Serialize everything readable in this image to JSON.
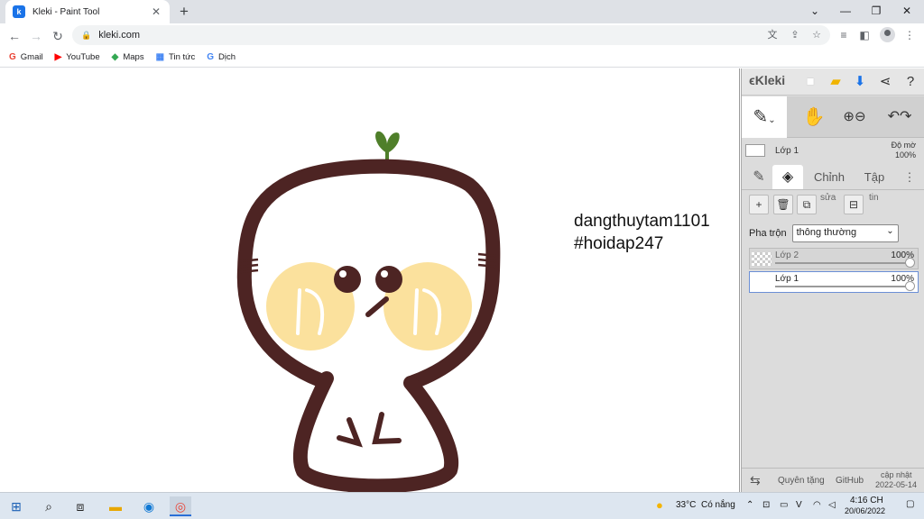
{
  "browser": {
    "tab_title": "Kleki - Paint Tool",
    "favicon_letter": "k",
    "url": "kleki.com",
    "bookmarks": [
      {
        "label": "Gmail",
        "icon": "G",
        "color": "#ea4335"
      },
      {
        "label": "YouTube",
        "icon": "▶",
        "color": "#ff0000"
      },
      {
        "label": "Maps",
        "icon": "◆",
        "color": "#34a853"
      },
      {
        "label": "Tin tức",
        "icon": "▦",
        "color": "#4285f4"
      },
      {
        "label": "Dịch",
        "icon": "G",
        "color": "#4285f4"
      }
    ]
  },
  "canvas": {
    "caption_line1": "dangthuytam1101",
    "caption_line2": "#hoidap247"
  },
  "kleki": {
    "logo": "Kleki",
    "active_layer": "Lớp 1",
    "opacity_label": "Độ mờ",
    "opacity_value": "100%",
    "tabs": {
      "adjust": "Chỉnh",
      "file": "Tập"
    },
    "actions": {
      "edit": "sửa",
      "info": "tin"
    },
    "blend_label": "Pha trộn",
    "blend_value": "thông thường",
    "layers": [
      {
        "name": "Lớp 2",
        "opacity": "100%"
      },
      {
        "name": "Lớp 1",
        "opacity": "100%"
      }
    ],
    "footer": {
      "donate": "Quyên tặng",
      "github": "GitHub",
      "updated_label": "cập nhật",
      "updated_date": "2022-05-14"
    }
  },
  "taskbar": {
    "temperature": "33°C",
    "weather": "Có nắng",
    "time": "4:16 CH",
    "date": "20/06/2022"
  },
  "colors": {
    "outline": "#4d2423",
    "cheek": "#fbe19d",
    "leaf": "#4f7f2a"
  }
}
